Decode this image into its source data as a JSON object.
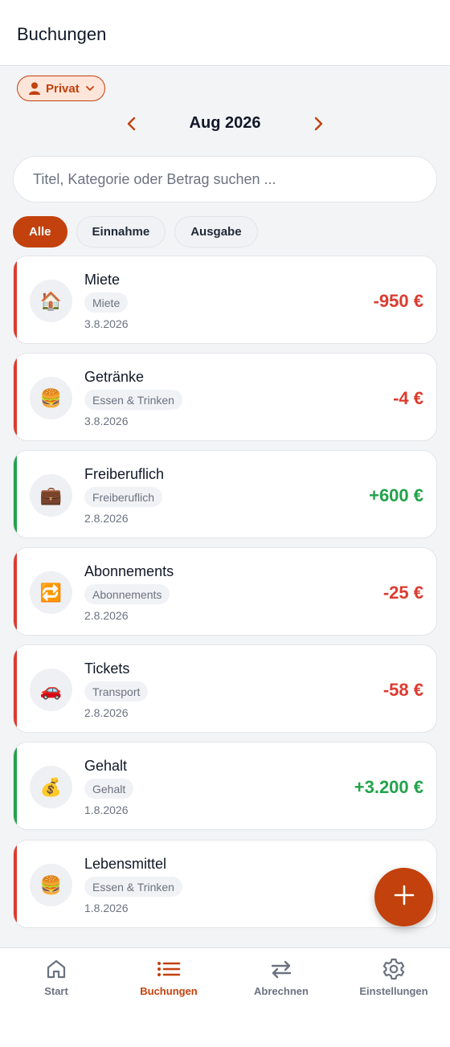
{
  "header": {
    "title": "Buchungen"
  },
  "account": {
    "label": "Privat",
    "icon": "user-icon"
  },
  "month": {
    "label": "Aug 2026",
    "prev_icon": "chevron-left-icon",
    "next_icon": "chevron-right-icon"
  },
  "search": {
    "placeholder": "Titel, Kategorie oder Betrag suchen ...",
    "value": ""
  },
  "filters": [
    {
      "label": "Alle",
      "active": true
    },
    {
      "label": "Einnahme",
      "active": false
    },
    {
      "label": "Ausgabe",
      "active": false
    }
  ],
  "transactions": [
    {
      "title": "Miete",
      "category": "Miete",
      "date": "3.8.2026",
      "amount": "-950 €",
      "type": "expense",
      "icon": "house-icon",
      "glyph": "🏠"
    },
    {
      "title": "Getränke",
      "category": "Essen & Trinken",
      "date": "3.8.2026",
      "amount": "-4 €",
      "type": "expense",
      "icon": "burger-icon",
      "glyph": "🍔"
    },
    {
      "title": "Freiberuflich",
      "category": "Freiberuflich",
      "date": "2.8.2026",
      "amount": "+600 €",
      "type": "income",
      "icon": "briefcase-icon",
      "glyph": "💼"
    },
    {
      "title": "Abonnements",
      "category": "Abonnements",
      "date": "2.8.2026",
      "amount": "-25 €",
      "type": "expense",
      "icon": "repeat-icon",
      "glyph": "🔁"
    },
    {
      "title": "Tickets",
      "category": "Transport",
      "date": "2.8.2026",
      "amount": "-58 €",
      "type": "expense",
      "icon": "car-icon",
      "glyph": "🚗"
    },
    {
      "title": "Gehalt",
      "category": "Gehalt",
      "date": "1.8.2026",
      "amount": "+3.200 €",
      "type": "income",
      "icon": "money-bag-icon",
      "glyph": "💰"
    },
    {
      "title": "Lebensmittel",
      "category": "Essen & Trinken",
      "date": "1.8.2026",
      "amount": "",
      "type": "expense",
      "icon": "burger-icon",
      "glyph": "🍔"
    }
  ],
  "fab": {
    "icon": "plus-icon"
  },
  "bottom_nav": [
    {
      "label": "Start",
      "icon": "home-icon",
      "active": false
    },
    {
      "label": "Buchungen",
      "icon": "list-icon",
      "active": true
    },
    {
      "label": "Abrechnen",
      "icon": "swap-arrows-icon",
      "active": false
    },
    {
      "label": "Einstellungen",
      "icon": "gear-icon",
      "active": false
    }
  ],
  "colors": {
    "accent": "#c2410c",
    "expense": "#dc3b2f",
    "income": "#22a34a"
  }
}
